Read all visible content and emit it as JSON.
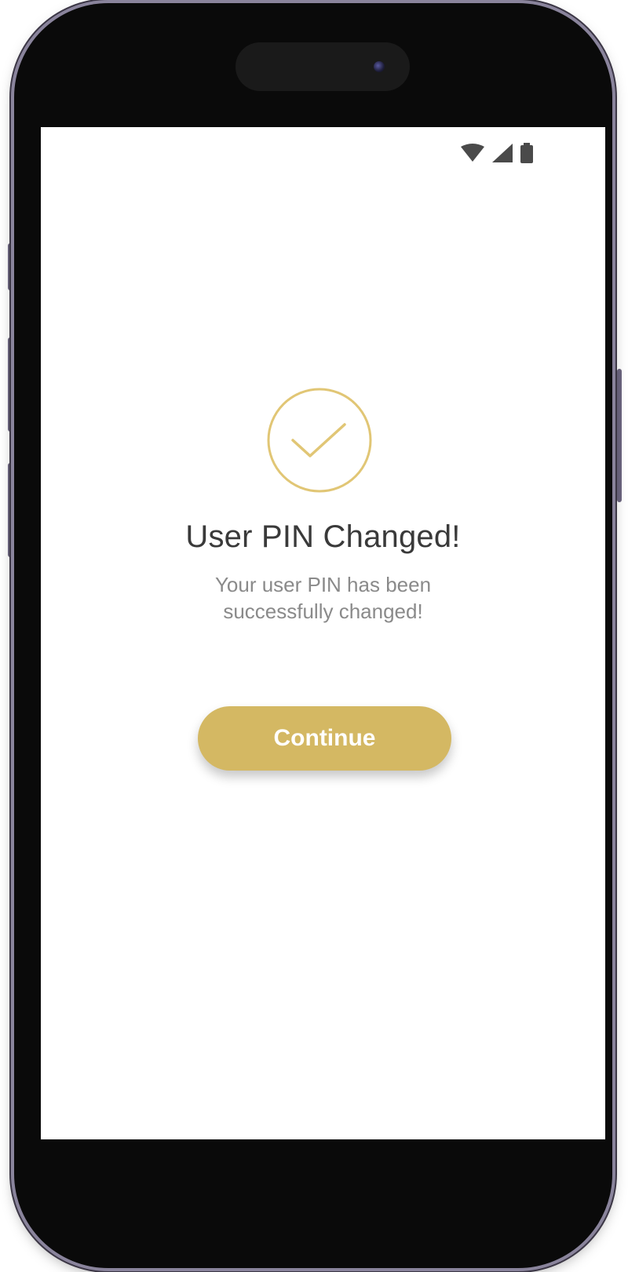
{
  "device": {
    "frame": "phone",
    "status_icons": [
      "wifi-icon",
      "cellular-signal-icon",
      "battery-icon"
    ]
  },
  "colors": {
    "accent": "#d4b863",
    "title_text": "#3a3a3a",
    "subtitle_text": "#8a8a8a",
    "button_text": "#ffffff"
  },
  "success": {
    "icon": "check-circle-icon",
    "title": "User PIN Changed!",
    "message_line1": "Your user PIN has been",
    "message_line2": "successfully changed!",
    "continue_label": "Continue"
  }
}
